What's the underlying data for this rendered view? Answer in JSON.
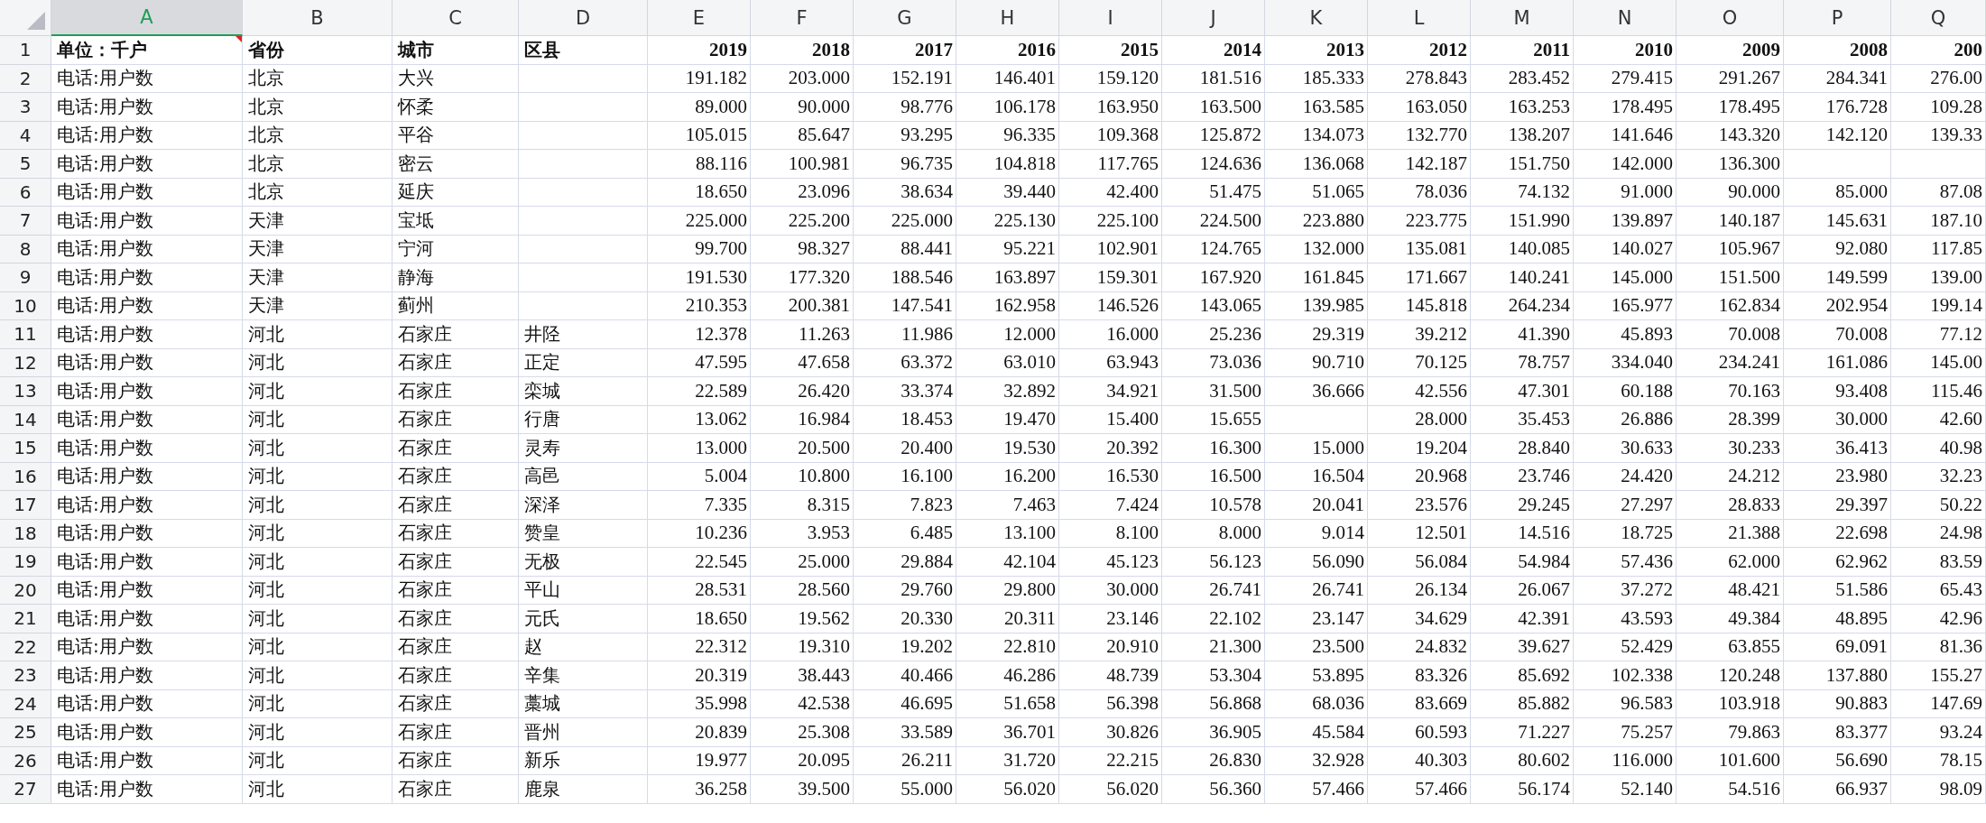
{
  "columns": [
    {
      "letter": "A",
      "selected": true
    },
    {
      "letter": "B",
      "selected": false
    },
    {
      "letter": "C",
      "selected": false
    },
    {
      "letter": "D",
      "selected": false
    },
    {
      "letter": "E",
      "selected": false
    },
    {
      "letter": "F",
      "selected": false
    },
    {
      "letter": "G",
      "selected": false
    },
    {
      "letter": "H",
      "selected": false
    },
    {
      "letter": "I",
      "selected": false
    },
    {
      "letter": "J",
      "selected": false
    },
    {
      "letter": "K",
      "selected": false
    },
    {
      "letter": "L",
      "selected": false
    },
    {
      "letter": "M",
      "selected": false
    },
    {
      "letter": "N",
      "selected": false
    },
    {
      "letter": "O",
      "selected": false
    },
    {
      "letter": "P",
      "selected": false
    },
    {
      "letter": "Q",
      "selected": false
    }
  ],
  "rows": [
    {
      "number": "1",
      "comment": true,
      "cells": [
        "单位：千户",
        "省份",
        "城市",
        "区县",
        "2019",
        "2018",
        "2017",
        "2016",
        "2015",
        "2014",
        "2013",
        "2012",
        "2011",
        "2010",
        "2009",
        "2008",
        "200"
      ]
    },
    {
      "number": "2",
      "comment": false,
      "cells": [
        "电话:用户数",
        "北京",
        "大兴",
        null,
        "191.182",
        "203.000",
        "152.191",
        "146.401",
        "159.120",
        "181.516",
        "185.333",
        "278.843",
        "283.452",
        "279.415",
        "291.267",
        "284.341",
        "276.00"
      ]
    },
    {
      "number": "3",
      "comment": false,
      "cells": [
        "电话:用户数",
        "北京",
        "怀柔",
        null,
        "89.000",
        "90.000",
        "98.776",
        "106.178",
        "163.950",
        "163.500",
        "163.585",
        "163.050",
        "163.253",
        "178.495",
        "178.495",
        "176.728",
        "109.28"
      ]
    },
    {
      "number": "4",
      "comment": false,
      "cells": [
        "电话:用户数",
        "北京",
        "平谷",
        null,
        "105.015",
        "85.647",
        "93.295",
        "96.335",
        "109.368",
        "125.872",
        "134.073",
        "132.770",
        "138.207",
        "141.646",
        "143.320",
        "142.120",
        "139.33"
      ]
    },
    {
      "number": "5",
      "comment": false,
      "cells": [
        "电话:用户数",
        "北京",
        "密云",
        null,
        "88.116",
        "100.981",
        "96.735",
        "104.818",
        "117.765",
        "124.636",
        "136.068",
        "142.187",
        "151.750",
        "142.000",
        "136.300",
        null,
        null
      ]
    },
    {
      "number": "6",
      "comment": false,
      "cells": [
        "电话:用户数",
        "北京",
        "延庆",
        null,
        "18.650",
        "23.096",
        "38.634",
        "39.440",
        "42.400",
        "51.475",
        "51.065",
        "78.036",
        "74.132",
        "91.000",
        "90.000",
        "85.000",
        "87.08"
      ]
    },
    {
      "number": "7",
      "comment": false,
      "cells": [
        "电话:用户数",
        "天津",
        "宝坻",
        null,
        "225.000",
        "225.200",
        "225.000",
        "225.130",
        "225.100",
        "224.500",
        "223.880",
        "223.775",
        "151.990",
        "139.897",
        "140.187",
        "145.631",
        "187.10"
      ]
    },
    {
      "number": "8",
      "comment": false,
      "cells": [
        "电话:用户数",
        "天津",
        "宁河",
        null,
        "99.700",
        "98.327",
        "88.441",
        "95.221",
        "102.901",
        "124.765",
        "132.000",
        "135.081",
        "140.085",
        "140.027",
        "105.967",
        "92.080",
        "117.85"
      ]
    },
    {
      "number": "9",
      "comment": false,
      "cells": [
        "电话:用户数",
        "天津",
        "静海",
        null,
        "191.530",
        "177.320",
        "188.546",
        "163.897",
        "159.301",
        "167.920",
        "161.845",
        "171.667",
        "140.241",
        "145.000",
        "151.500",
        "149.599",
        "139.00"
      ]
    },
    {
      "number": "10",
      "comment": false,
      "cells": [
        "电话:用户数",
        "天津",
        "蓟州",
        null,
        "210.353",
        "200.381",
        "147.541",
        "162.958",
        "146.526",
        "143.065",
        "139.985",
        "145.818",
        "264.234",
        "165.977",
        "162.834",
        "202.954",
        "199.14"
      ]
    },
    {
      "number": "11",
      "comment": false,
      "cells": [
        "电话:用户数",
        "河北",
        "石家庄",
        "井陉",
        "12.378",
        "11.263",
        "11.986",
        "12.000",
        "16.000",
        "25.236",
        "29.319",
        "39.212",
        "41.390",
        "45.893",
        "70.008",
        "70.008",
        "77.12"
      ]
    },
    {
      "number": "12",
      "comment": false,
      "cells": [
        "电话:用户数",
        "河北",
        "石家庄",
        "正定",
        "47.595",
        "47.658",
        "63.372",
        "63.010",
        "63.943",
        "73.036",
        "90.710",
        "70.125",
        "78.757",
        "334.040",
        "234.241",
        "161.086",
        "145.00"
      ]
    },
    {
      "number": "13",
      "comment": false,
      "cells": [
        "电话:用户数",
        "河北",
        "石家庄",
        "栾城",
        "22.589",
        "26.420",
        "33.374",
        "32.892",
        "34.921",
        "31.500",
        "36.666",
        "42.556",
        "47.301",
        "60.188",
        "70.163",
        "93.408",
        "115.46"
      ]
    },
    {
      "number": "14",
      "comment": false,
      "cells": [
        "电话:用户数",
        "河北",
        "石家庄",
        "行唐",
        "13.062",
        "16.984",
        "18.453",
        "19.470",
        "15.400",
        "15.655",
        null,
        "28.000",
        "35.453",
        "26.886",
        "28.399",
        "30.000",
        "42.60"
      ]
    },
    {
      "number": "15",
      "comment": false,
      "cells": [
        "电话:用户数",
        "河北",
        "石家庄",
        "灵寿",
        "13.000",
        "20.500",
        "20.400",
        "19.530",
        "20.392",
        "16.300",
        "15.000",
        "19.204",
        "28.840",
        "30.633",
        "30.233",
        "36.413",
        "40.98"
      ]
    },
    {
      "number": "16",
      "comment": false,
      "cells": [
        "电话:用户数",
        "河北",
        "石家庄",
        "高邑",
        "5.004",
        "10.800",
        "16.100",
        "16.200",
        "16.530",
        "16.500",
        "16.504",
        "20.968",
        "23.746",
        "24.420",
        "24.212",
        "23.980",
        "32.23"
      ]
    },
    {
      "number": "17",
      "comment": false,
      "cells": [
        "电话:用户数",
        "河北",
        "石家庄",
        "深泽",
        "7.335",
        "8.315",
        "7.823",
        "7.463",
        "7.424",
        "10.578",
        "20.041",
        "23.576",
        "29.245",
        "27.297",
        "28.833",
        "29.397",
        "50.22"
      ]
    },
    {
      "number": "18",
      "comment": false,
      "cells": [
        "电话:用户数",
        "河北",
        "石家庄",
        "赞皇",
        "10.236",
        "3.953",
        "6.485",
        "13.100",
        "8.100",
        "8.000",
        "9.014",
        "12.501",
        "14.516",
        "18.725",
        "21.388",
        "22.698",
        "24.98"
      ]
    },
    {
      "number": "19",
      "comment": false,
      "cells": [
        "电话:用户数",
        "河北",
        "石家庄",
        "无极",
        "22.545",
        "25.000",
        "29.884",
        "42.104",
        "45.123",
        "56.123",
        "56.090",
        "56.084",
        "54.984",
        "57.436",
        "62.000",
        "62.962",
        "83.59"
      ]
    },
    {
      "number": "20",
      "comment": false,
      "cells": [
        "电话:用户数",
        "河北",
        "石家庄",
        "平山",
        "28.531",
        "28.560",
        "29.760",
        "29.800",
        "30.000",
        "26.741",
        "26.741",
        "26.134",
        "26.067",
        "37.272",
        "48.421",
        "51.586",
        "65.43"
      ]
    },
    {
      "number": "21",
      "comment": false,
      "cells": [
        "电话:用户数",
        "河北",
        "石家庄",
        "元氏",
        "18.650",
        "19.562",
        "20.330",
        "20.311",
        "23.146",
        "22.102",
        "23.147",
        "34.629",
        "42.391",
        "43.593",
        "49.384",
        "48.895",
        "42.96"
      ]
    },
    {
      "number": "22",
      "comment": false,
      "cells": [
        "电话:用户数",
        "河北",
        "石家庄",
        "赵",
        "22.312",
        "19.310",
        "19.202",
        "22.810",
        "20.910",
        "21.300",
        "23.500",
        "24.832",
        "39.627",
        "52.429",
        "63.855",
        "69.091",
        "81.36"
      ]
    },
    {
      "number": "23",
      "comment": false,
      "cells": [
        "电话:用户数",
        "河北",
        "石家庄",
        "辛集",
        "20.319",
        "38.443",
        "40.466",
        "46.286",
        "48.739",
        "53.304",
        "53.895",
        "83.326",
        "85.692",
        "102.338",
        "120.248",
        "137.880",
        "155.27"
      ]
    },
    {
      "number": "24",
      "comment": false,
      "cells": [
        "电话:用户数",
        "河北",
        "石家庄",
        "藁城",
        "35.998",
        "42.538",
        "46.695",
        "51.658",
        "56.398",
        "56.868",
        "68.036",
        "83.669",
        "85.882",
        "96.583",
        "103.918",
        "90.883",
        "147.69"
      ]
    },
    {
      "number": "25",
      "comment": false,
      "cells": [
        "电话:用户数",
        "河北",
        "石家庄",
        "晋州",
        "20.839",
        "25.308",
        "33.589",
        "36.701",
        "30.826",
        "36.905",
        "45.584",
        "60.593",
        "71.227",
        "75.257",
        "79.863",
        "83.377",
        "93.24"
      ]
    },
    {
      "number": "26",
      "comment": false,
      "cells": [
        "电话:用户数",
        "河北",
        "石家庄",
        "新乐",
        "19.977",
        "20.095",
        "26.211",
        "31.720",
        "22.215",
        "26.830",
        "32.928",
        "40.303",
        "80.602",
        "116.000",
        "101.600",
        "56.690",
        "78.15"
      ]
    },
    {
      "number": "27",
      "comment": false,
      "cells": [
        "电话:用户数",
        "河北",
        "石家庄",
        "鹿泉",
        "36.258",
        "39.500",
        "55.000",
        "56.020",
        "56.020",
        "56.360",
        "57.466",
        "57.466",
        "56.174",
        "52.140",
        "54.516",
        "66.937",
        "98.09"
      ]
    }
  ]
}
